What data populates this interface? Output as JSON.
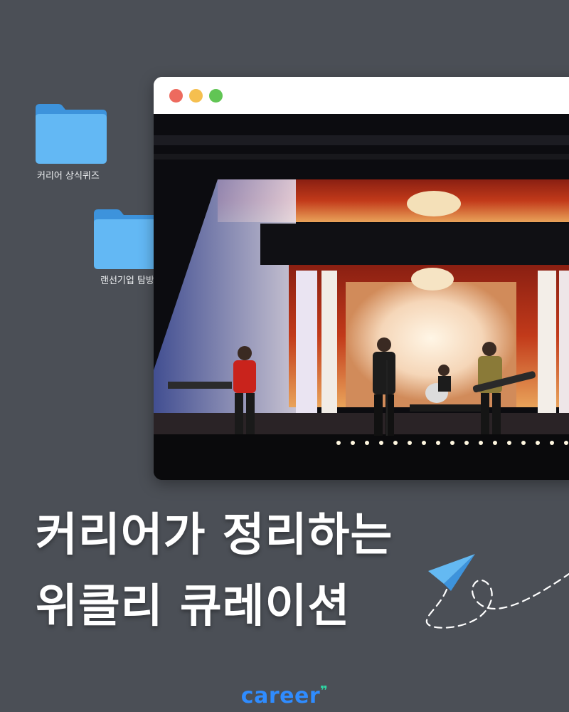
{
  "desktop": {
    "folders": [
      {
        "label": "커리어 상식퀴즈"
      },
      {
        "label": "랜선기업 탐방"
      }
    ]
  },
  "window": {
    "traffic_lights": {
      "close": "#ed6a5e",
      "minimize": "#f5bf4f",
      "zoom": "#61c554"
    },
    "image": {
      "description_icon": "concert-photo"
    }
  },
  "headline": {
    "line1": "커리어가 정리하는",
    "line2": "위클리 큐레이션"
  },
  "brand": {
    "name": "career",
    "mark": "❞",
    "color": "#2f8cff"
  },
  "colors": {
    "background": "#4b4f56",
    "folder": "#5aaef0"
  }
}
